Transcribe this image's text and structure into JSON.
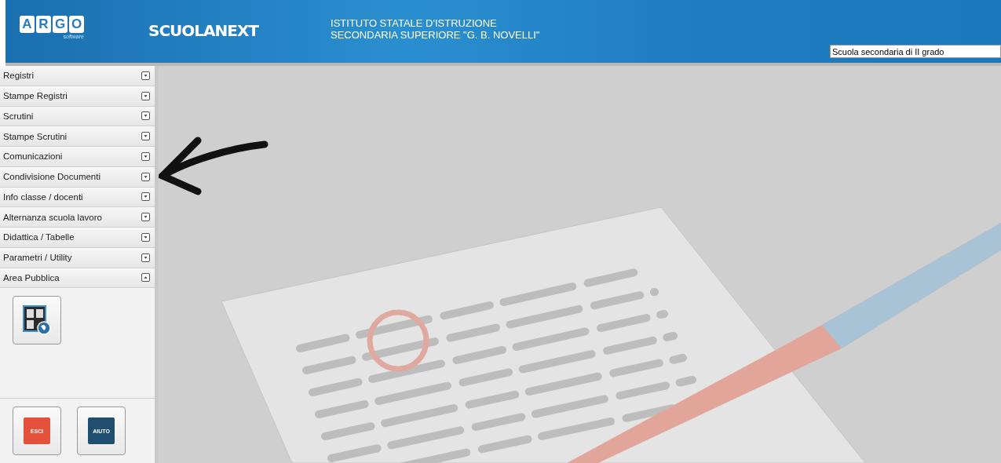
{
  "header": {
    "logo_letters": [
      "A",
      "R",
      "G",
      "O"
    ],
    "logo_subtitle": "software",
    "product": "SCUOLANEXT",
    "school_lines": [
      "ISTITUTO STATALE D'ISTRUZIONE",
      "SECONDARIA SUPERIORE \"G. B. NOVELLI\""
    ],
    "school_type": "Scuola secondaria di II grado"
  },
  "sidebar": {
    "items": [
      {
        "label": "Registri",
        "expanded": false
      },
      {
        "label": "Stampe Registri",
        "expanded": false
      },
      {
        "label": "Scrutini",
        "expanded": false
      },
      {
        "label": "Stampe Scrutini",
        "expanded": false
      },
      {
        "label": "Comunicazioni",
        "expanded": false
      },
      {
        "label": "Condivisione Documenti",
        "expanded": false
      },
      {
        "label": "Info classe / docenti",
        "expanded": false
      },
      {
        "label": "Alternanza scuola lavoro",
        "expanded": false
      },
      {
        "label": "Didattica / Tabelle",
        "expanded": false
      },
      {
        "label": "Parametri / Utility",
        "expanded": false
      },
      {
        "label": "Area Pubblica",
        "expanded": true
      }
    ],
    "bottom_buttons": [
      {
        "label": "ESCI",
        "kind": "exit"
      },
      {
        "label": "AIUTO",
        "kind": "help"
      }
    ]
  }
}
